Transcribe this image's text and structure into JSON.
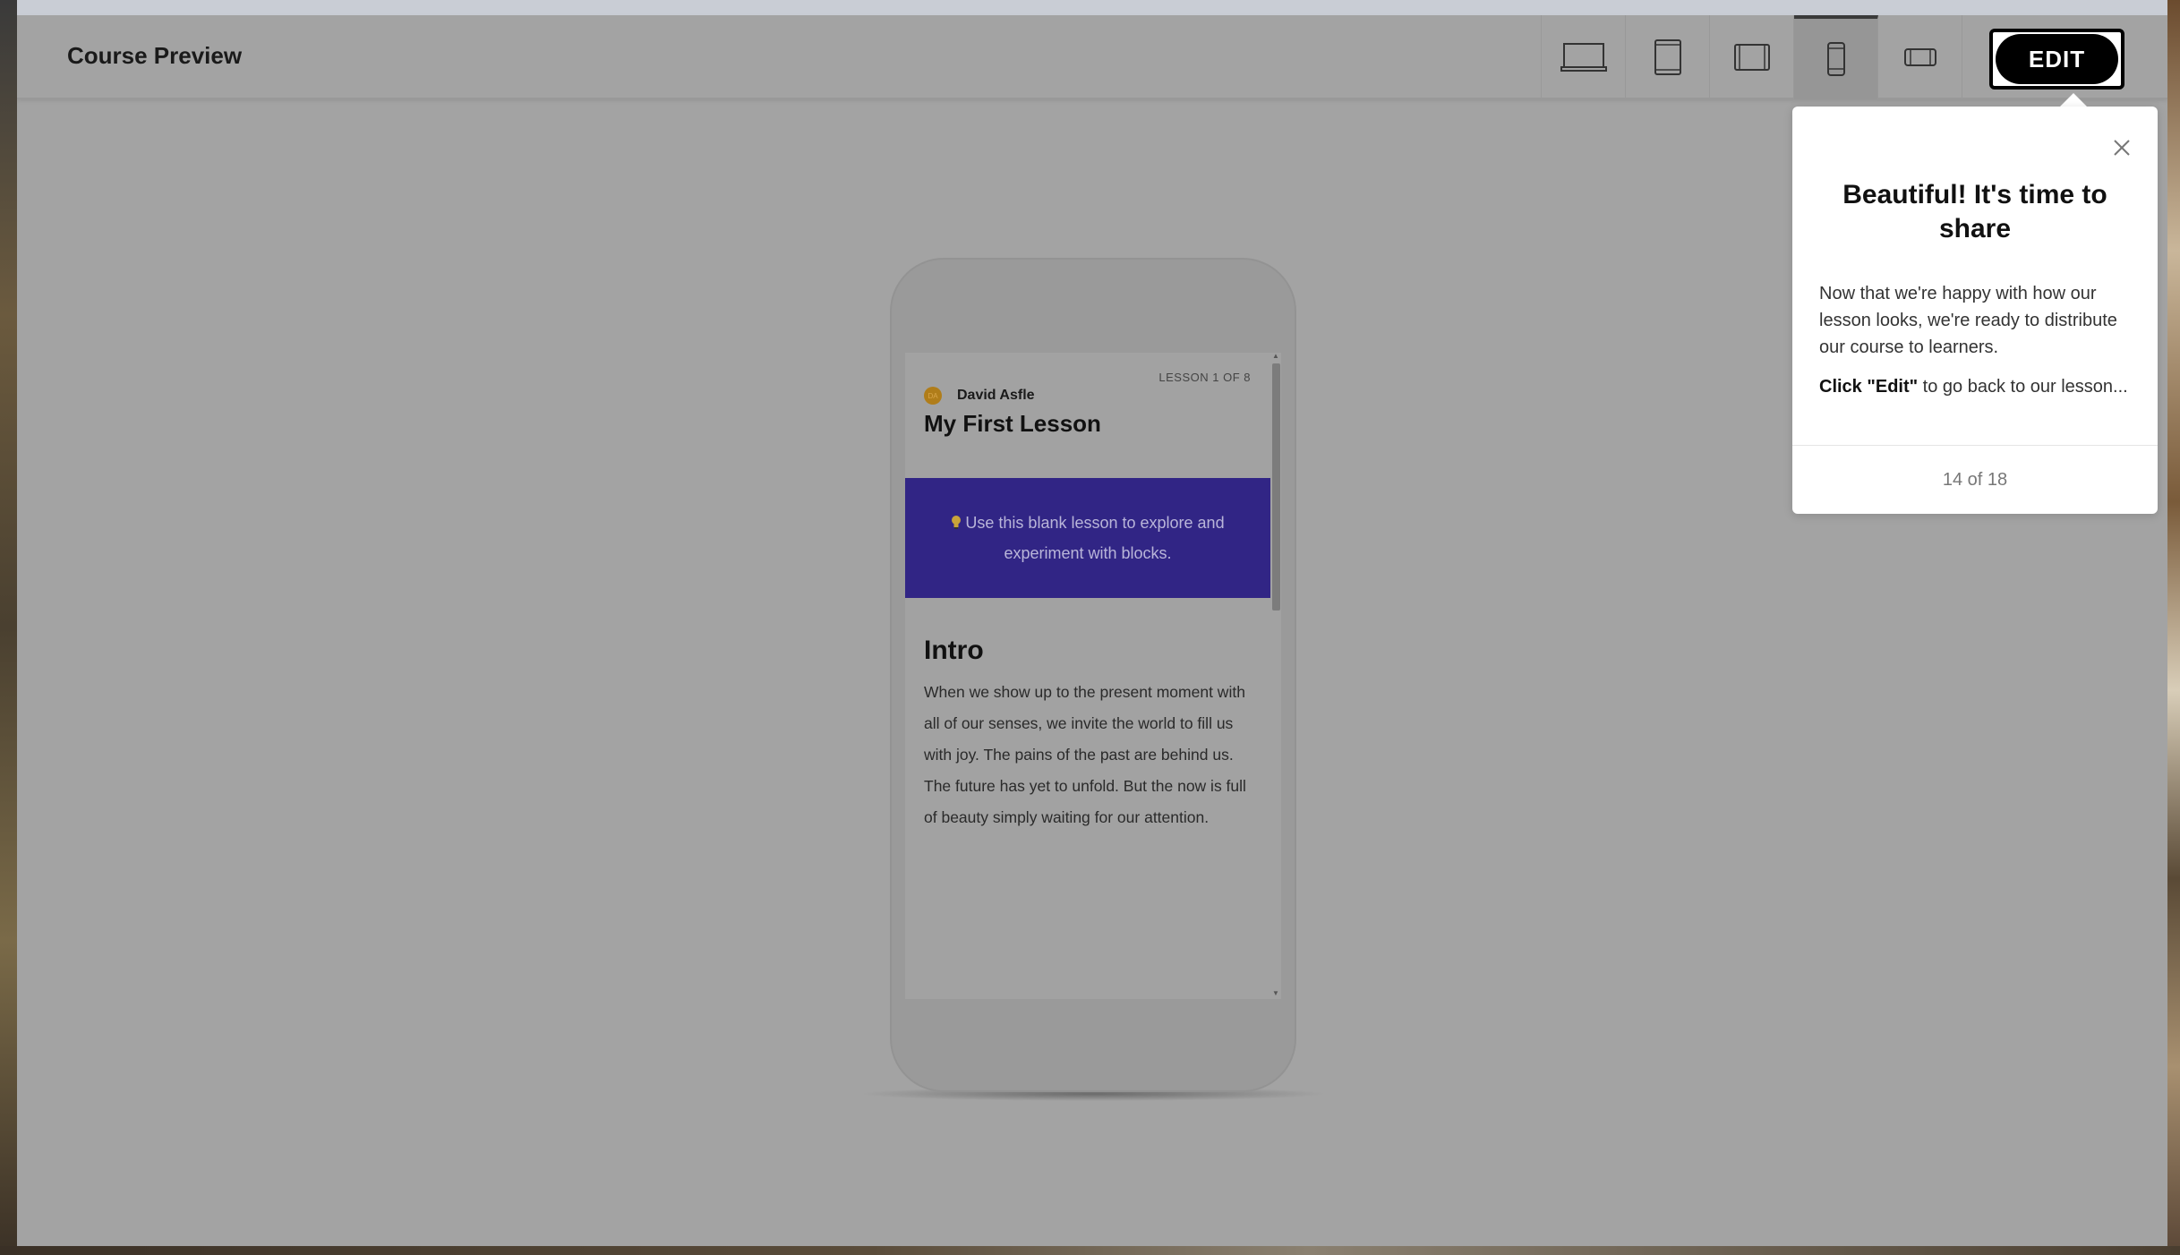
{
  "header": {
    "title": "Course Preview",
    "edit_label": "EDIT",
    "devices": [
      {
        "name": "desktop-icon",
        "active": false
      },
      {
        "name": "tablet-portrait-icon",
        "active": false
      },
      {
        "name": "tablet-landscape-icon",
        "active": false
      },
      {
        "name": "mobile-portrait-icon",
        "active": true
      },
      {
        "name": "mobile-landscape-icon",
        "active": false
      }
    ]
  },
  "lesson": {
    "count_label": "LESSON 1 OF 8",
    "author_initials": "DA",
    "author": "David Asfle",
    "title": "My First Lesson",
    "callout": "Use this blank lesson to explore and experiment with blocks.",
    "section_title": "Intro",
    "body": "When we show up to the present moment with all of our senses, we invite the world to fill us with joy. The pains of the past are behind us. The future has yet to unfold. But the now is full of beauty simply waiting for our attention."
  },
  "popover": {
    "title": "Beautiful! It's time to share",
    "body_1": "Now that we're happy with how our lesson looks, we're ready to distribute our course to learners.",
    "body_2_bold": "Click",
    "body_2_quote": "\"Edit\"",
    "body_2_rest": " to go back to our lesson...",
    "step_label": "14 of 18"
  },
  "colors": {
    "overlay_gray": "#a3a3a3",
    "callout_bg": "#312585",
    "edit_button": "#000000",
    "popover_bg": "#ffffff"
  }
}
